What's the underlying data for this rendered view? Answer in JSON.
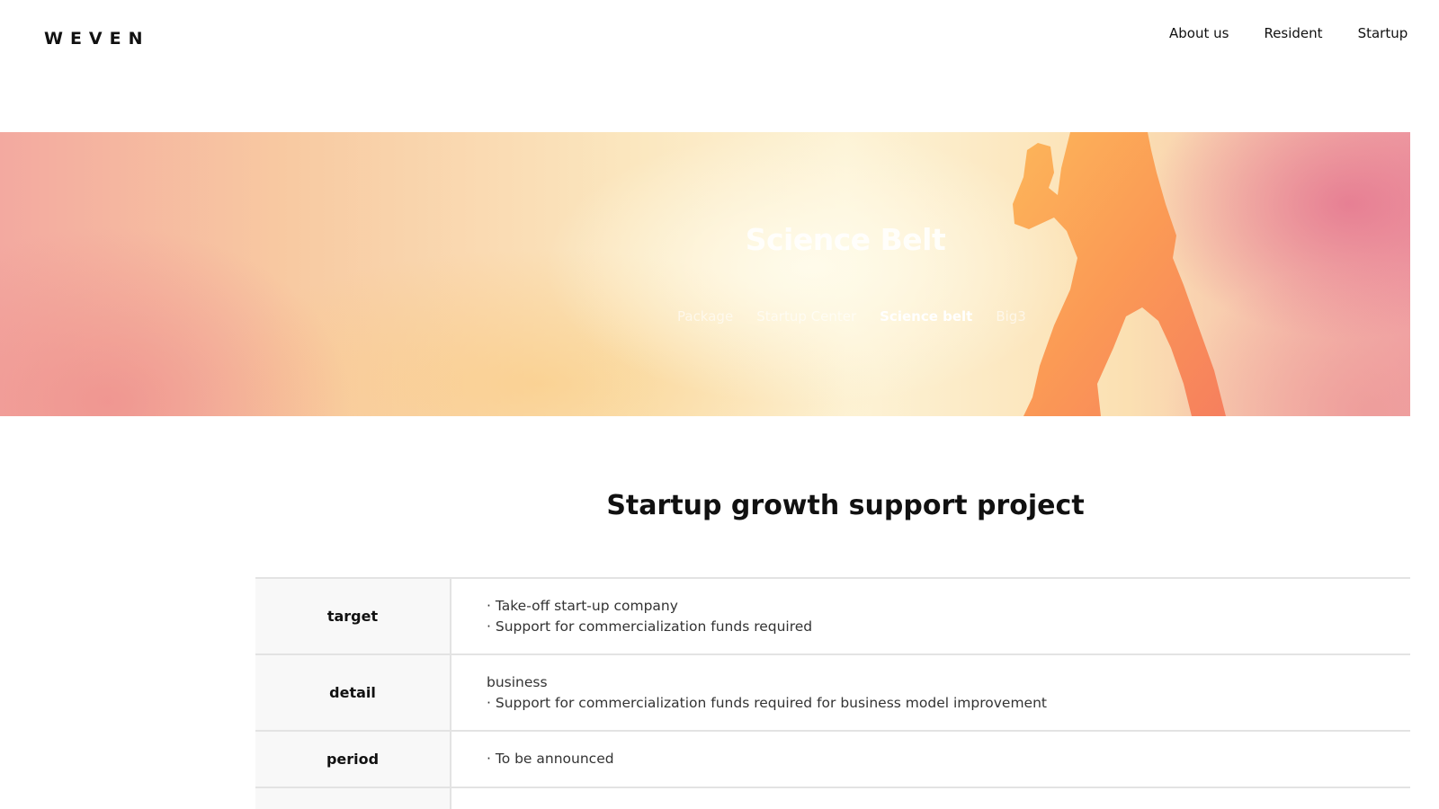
{
  "header": {
    "logo": "WEVEN",
    "nav": [
      "About us",
      "Resident",
      "Startup"
    ]
  },
  "hero": {
    "title": "Science Belt",
    "tabs": [
      {
        "label": "Package",
        "active": false
      },
      {
        "label": "Startup Center",
        "active": false
      },
      {
        "label": "Science belt",
        "active": true
      },
      {
        "label": "Big3",
        "active": false
      }
    ]
  },
  "main": {
    "title": "Startup growth support project",
    "rows": [
      {
        "label": "target",
        "lines": [
          "· Take-off start-up company",
          "· Support for commercialization funds required"
        ]
      },
      {
        "label": "detail",
        "lines": [
          "business",
          "· Support for commercialization funds required for business model improvement"
        ]
      },
      {
        "label": "period",
        "lines": [
          "· To be announced"
        ]
      }
    ]
  },
  "colors": {
    "hero_silhouette": "#fb9a55",
    "table_border": "#e3e3e3",
    "table_header_bg": "#f8f8f8"
  }
}
